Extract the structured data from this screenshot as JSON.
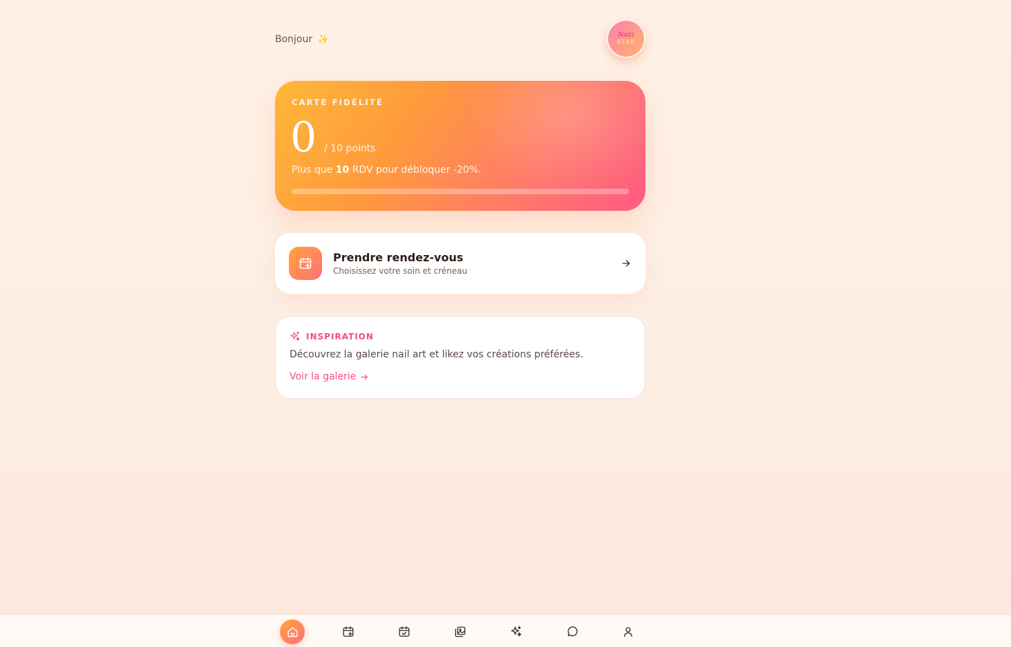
{
  "header": {
    "greeting": "Bonjour",
    "greeting_emoji": "✨",
    "avatar_line1": "Nailz",
    "avatar_line2": "STAR"
  },
  "loyalty": {
    "label": "CARTE FIDÉLITÉ",
    "points": "0",
    "points_of": "/ 10 points",
    "msg_prefix": "Plus que ",
    "msg_count": "10",
    "msg_suffix": " RDV pour débloquer -20%.",
    "progress_fraction": 0
  },
  "booking": {
    "title": "Prendre rendez-vous",
    "subtitle": "Choisissez votre soin et créneau",
    "icon": "calendar-plus-icon"
  },
  "inspiration": {
    "label": "INSPIRATION",
    "text": "Découvrez la galerie nail art et likez vos créations préférées.",
    "link": "Voir la galerie",
    "icon": "sparkles-icon"
  },
  "nav": {
    "items": [
      {
        "name": "home",
        "icon": "home-icon",
        "active": true
      },
      {
        "name": "book",
        "icon": "calendar-plus-icon",
        "active": false
      },
      {
        "name": "appointments",
        "icon": "calendar-check-icon",
        "active": false
      },
      {
        "name": "gallery",
        "icon": "images-icon",
        "active": false
      },
      {
        "name": "inspiration",
        "icon": "sparkles-icon",
        "active": false
      },
      {
        "name": "messages",
        "icon": "chat-icon",
        "active": false
      },
      {
        "name": "profile",
        "icon": "user-icon",
        "active": false
      }
    ]
  },
  "colors": {
    "accent_pink": "#f0507a",
    "accent_orange": "#ffa538",
    "background": "#fff1e6"
  }
}
